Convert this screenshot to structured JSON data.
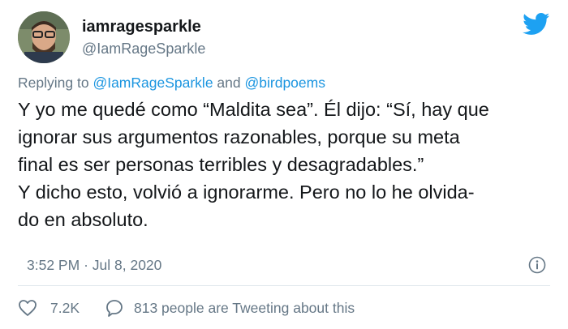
{
  "user": {
    "display_name": "iamragesparkle",
    "handle": "@IamRageSparkle",
    "avatar_icon": "avatar-photo"
  },
  "brand": {
    "icon": "twitter-bird-icon",
    "color": "#1da1f2"
  },
  "reply": {
    "prefix": "Replying to",
    "mention_1": "@IamRageSparkle",
    "conjunction": "and",
    "mention_2": "@birdpoems"
  },
  "tweet": {
    "lines": [
      "Y yo me quedé como “Maldita sea”. Él dijo: “Sí, hay que",
      "ignorar sus argumentos razonables, porque su meta",
      "final es ser personas terribles y desagradables.”",
      "Y dicho esto, volvió a ignorarme. Pero no lo he olvida-",
      "do en absoluto."
    ]
  },
  "meta": {
    "time": "3:52 PM",
    "separator": "·",
    "date": "Jul 8, 2020",
    "info_icon": "info-icon"
  },
  "actions": {
    "like_icon": "heart-icon",
    "like_count": "7.2K",
    "comment_icon": "comment-icon",
    "comment_text": "813 people are Tweeting about this"
  },
  "colors": {
    "link": "#1b95e0",
    "muted": "#657786",
    "text": "#14171a",
    "divider": "#e1e8ed"
  }
}
